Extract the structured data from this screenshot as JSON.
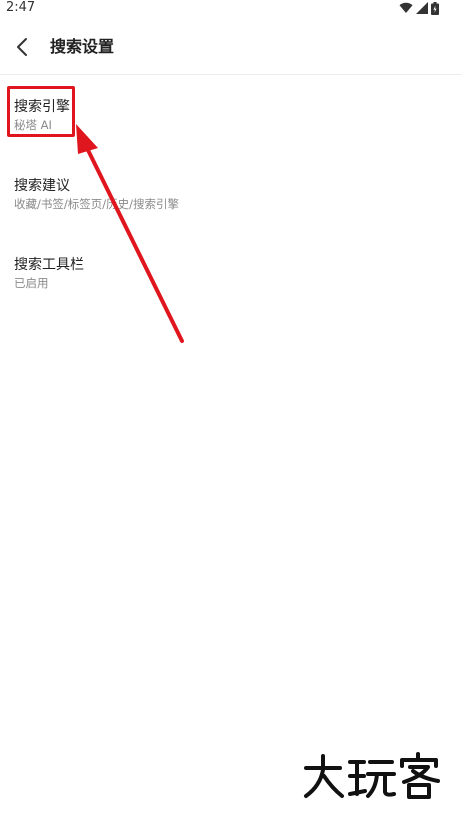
{
  "status_bar": {
    "time": "2:47",
    "icons": [
      "wifi-icon",
      "signal-icon",
      "battery-icon"
    ]
  },
  "header": {
    "title": "搜索设置",
    "back_icon": "chevron-left-icon"
  },
  "settings": [
    {
      "title": "搜索引擎",
      "subtitle": "秘塔 AI"
    },
    {
      "title": "搜索建议",
      "subtitle": "收藏/书签/标签页/历史/搜索引擎"
    },
    {
      "title": "搜索工具栏",
      "subtitle": "已启用"
    }
  ],
  "annotation": {
    "color": "#e0161e"
  },
  "watermark": {
    "text": "大玩客"
  },
  "colors": {
    "background": "#ffffff",
    "text_primary": "#222222",
    "text_secondary": "#8a8a8a",
    "annotation_red": "#e0161e"
  }
}
